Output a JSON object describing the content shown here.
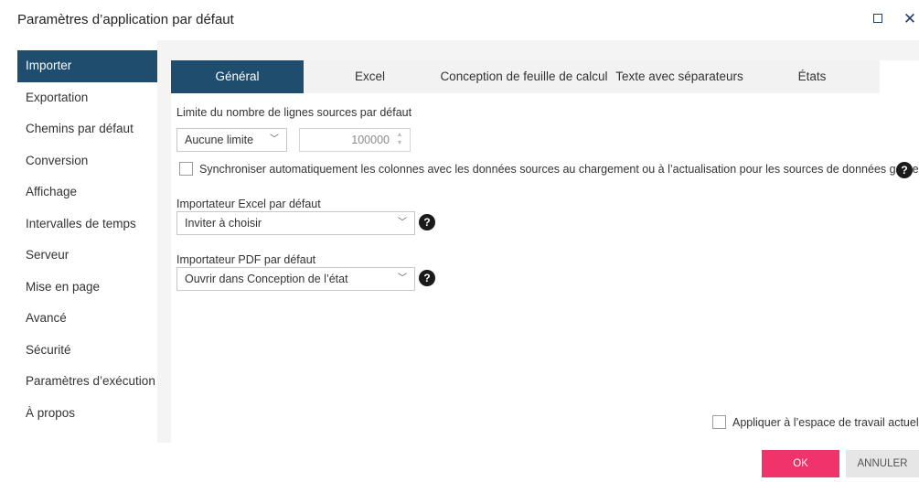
{
  "window": {
    "title": "Paramètres d’application par défaut",
    "close_glyph": "✕"
  },
  "sidebar": {
    "items": [
      {
        "label": "Importer",
        "active": true
      },
      {
        "label": "Exportation"
      },
      {
        "label": "Chemins par défaut"
      },
      {
        "label": "Conversion"
      },
      {
        "label": "Affichage"
      },
      {
        "label": "Intervalles de temps"
      },
      {
        "label": "Serveur"
      },
      {
        "label": "Mise en page"
      },
      {
        "label": "Avancé"
      },
      {
        "label": "Sécurité"
      },
      {
        "label": "Paramètres d’exécution"
      },
      {
        "label": "À propos"
      }
    ]
  },
  "tabs": [
    {
      "label": "Général",
      "active": true
    },
    {
      "label": "Excel"
    },
    {
      "label": "Conception de feuille de calcul"
    },
    {
      "label": "Texte avec séparateurs"
    },
    {
      "label": "États"
    }
  ],
  "general": {
    "row_limit_label": "Limite du nombre de lignes sources par défaut",
    "row_limit_select": "Aucune limite",
    "row_limit_value": "100000",
    "sync_columns_label": "Synchroniser automatiquement les colonnes avec les données sources au chargement ou à l’actualisation pour les sources de données gérées.",
    "sync_columns_checked": false,
    "excel_importer_label": "Importateur Excel par défaut",
    "excel_importer_value": "Inviter à choisir",
    "pdf_importer_label": "Importateur PDF par défaut",
    "pdf_importer_value": "Ouvrir dans Conception de l’état",
    "help_glyph": "?"
  },
  "footer": {
    "apply_workspace_label": "Appliquer à l’espace de travail actuel",
    "apply_workspace_checked": false,
    "ok_label": "OK",
    "cancel_label": "ANNULER"
  },
  "colors": {
    "accent": "#1f4d6e",
    "ok_button": "#f0336a",
    "panel_bg": "#f4f4f4"
  }
}
